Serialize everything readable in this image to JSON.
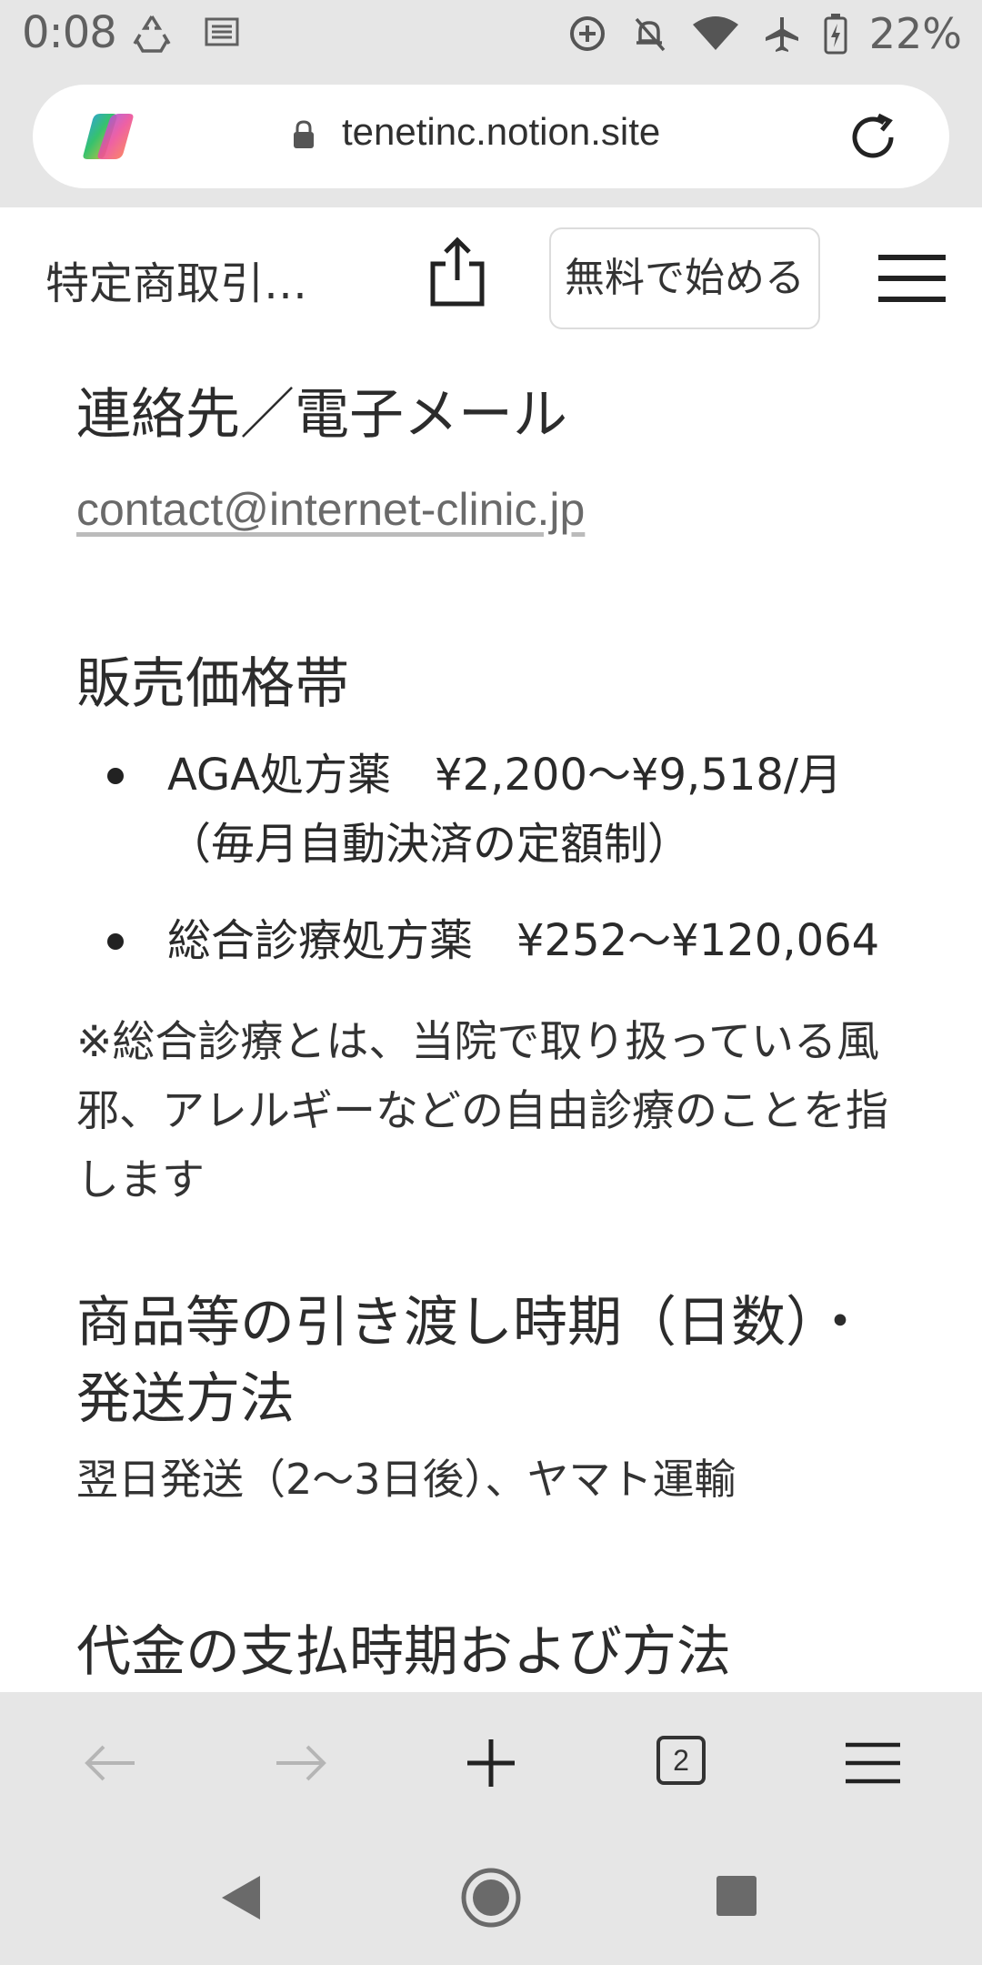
{
  "status_bar": {
    "time": "0:08",
    "battery_percent": "22%",
    "icons_left": [
      "recycle-icon",
      "news-icon"
    ],
    "icons_right": [
      "data-saver-icon",
      "mute-icon",
      "wifi-icon",
      "airplane-icon",
      "battery-charging-icon"
    ]
  },
  "browser": {
    "url": "tenetinc.notion.site",
    "tab_count": "2"
  },
  "notion_header": {
    "title": "特定商取引に...",
    "start_button": "無料で始める"
  },
  "content": {
    "contact_heading": "連絡先／電子メール",
    "contact_email": "contact@internet-clinic.jp",
    "price_heading": "販売価格帯",
    "price_items": [
      "AGA処方薬　¥2,200〜¥9,518/月（毎月自動決済の定額制）",
      "総合診療処方薬　¥252〜¥120,064"
    ],
    "price_note": "※総合診療とは、当院で取り扱っている風邪、アレルギーなどの自由診療のことを指します",
    "delivery_heading": "商品等の引き渡し時期（日数）・発送方法",
    "delivery_text": "翌日発送（2〜3日後）、ヤマト運輸",
    "payment_heading": "代金の支払時期および方法"
  },
  "colors": {
    "chrome_bg": "#e6e6e6",
    "page_bg": "#ffffff",
    "text": "#2c2c2c",
    "link": "#6a6a6a"
  }
}
